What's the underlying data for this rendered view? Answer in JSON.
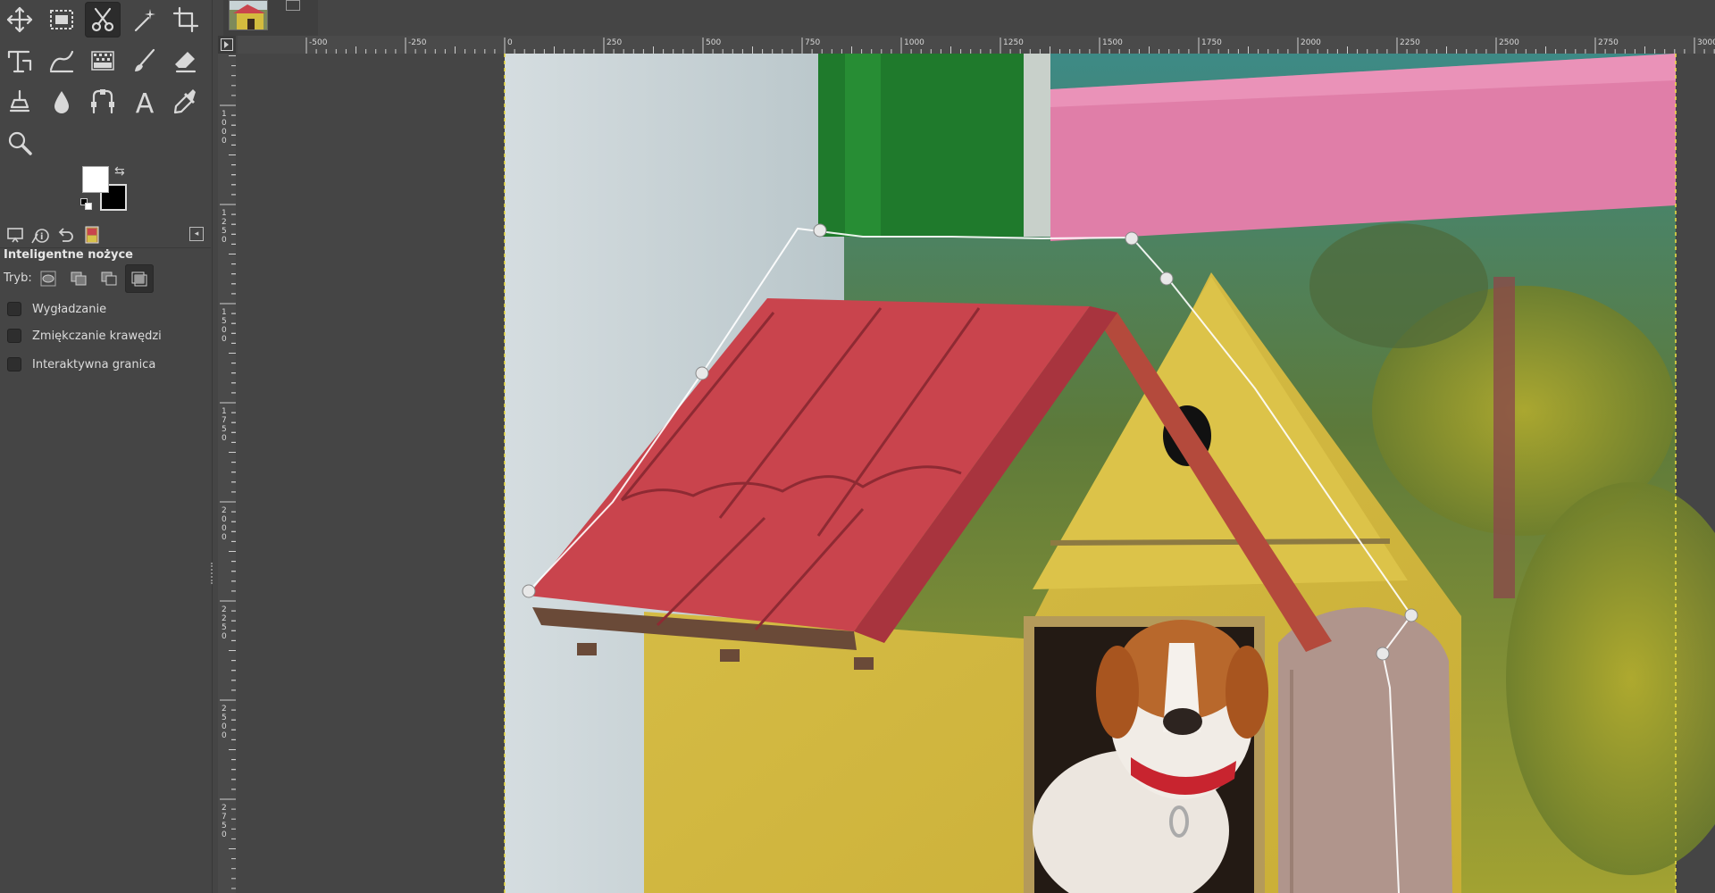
{
  "toolbox": {
    "tools": [
      {
        "id": "move",
        "icon": "move-icon",
        "active": false
      },
      {
        "id": "rect-select",
        "icon": "rectangle-select-icon",
        "active": false
      },
      {
        "id": "scissors",
        "icon": "scissors-select-icon",
        "active": true
      },
      {
        "id": "fuzzy-select",
        "icon": "magic-wand-icon",
        "active": false
      },
      {
        "id": "crop",
        "icon": "crop-icon",
        "active": false
      },
      {
        "id": "unified-transform",
        "icon": "transform-icon",
        "active": false
      },
      {
        "id": "warp",
        "icon": "warp-transform-icon",
        "active": false
      },
      {
        "id": "gradient",
        "icon": "gradient-icon",
        "active": false
      },
      {
        "id": "paintbrush",
        "icon": "paintbrush-icon",
        "active": false
      },
      {
        "id": "eraser",
        "icon": "eraser-icon",
        "active": false
      },
      {
        "id": "clone",
        "icon": "clone-stamp-icon",
        "active": false
      },
      {
        "id": "smudge",
        "icon": "drop-icon",
        "active": false
      },
      {
        "id": "paths",
        "icon": "paths-icon",
        "active": false
      },
      {
        "id": "text",
        "icon": "text-icon",
        "active": false
      },
      {
        "id": "color-picker",
        "icon": "eyedropper-icon",
        "active": false
      },
      {
        "id": "zoom",
        "icon": "zoom-icon",
        "active": false
      }
    ],
    "foreground_color": "#ffffff",
    "background_color": "#000000"
  },
  "dock_tabs": [
    "tool-options-icon",
    "device-status-icon",
    "undo-history-icon",
    "images-icon"
  ],
  "tool_options": {
    "title": "Inteligentne nożyce",
    "mode_label": "Tryb:",
    "modes": [
      "replace-mode-icon",
      "add-mode-icon",
      "subtract-mode-icon",
      "intersect-mode-icon"
    ],
    "active_mode_index": 3,
    "options": [
      {
        "label": "Wygładzanie",
        "checked": false
      },
      {
        "label": "Zmiękczanie krawędzi",
        "checked": false
      },
      {
        "label": "Interaktywna granica",
        "checked": false
      }
    ]
  },
  "ruler": {
    "h_labels": [
      "-500",
      "-250",
      "0",
      "250",
      "500",
      "750",
      "1000",
      "1250",
      "1500",
      "1750",
      "2000",
      "2250",
      "2500",
      "2750",
      "3000"
    ],
    "v_labels": [
      "1000",
      "1250",
      "1500",
      "1750",
      "2000",
      "2250",
      "2500",
      "2750"
    ]
  },
  "canvas": {
    "selection_tool": "Intelligent Scissors",
    "colors": {
      "wall": "#c8d3d6",
      "pillar": "#1f7a2c",
      "banner": "#e07ea8",
      "roof": "#c9444d",
      "house_body": "#d4bb3e",
      "door": "#b0958c",
      "foliage": "#8fa03a"
    }
  }
}
